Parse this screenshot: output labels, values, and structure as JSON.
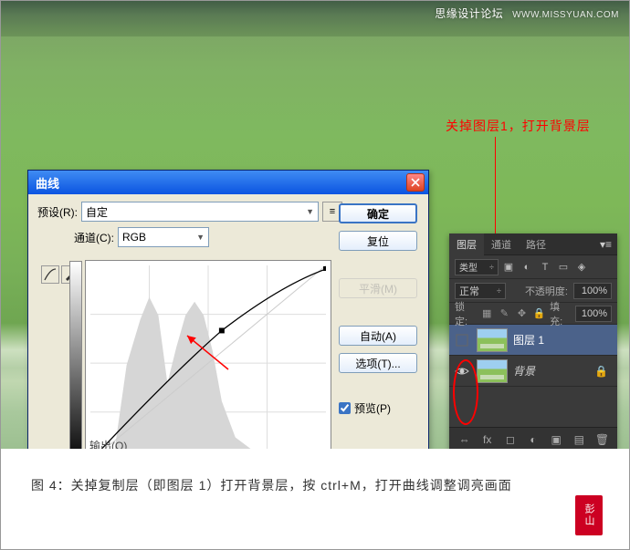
{
  "watermark": {
    "cn": "思缘设计论坛",
    "en": "WWW.MISSYUAN.COM"
  },
  "annotation": "关掉图层1，打开背景层",
  "curves": {
    "title": "曲线",
    "preset_label": "预设(R):",
    "preset_value": "自定",
    "channel_label": "通道(C):",
    "channel_value": "RGB",
    "output_label": "输出(O)",
    "buttons": {
      "ok": "确定",
      "cancel": "复位",
      "smooth": "平滑(M)",
      "auto": "自动(A)",
      "options": "选项(T)..."
    },
    "preview_label": "预览(P)"
  },
  "layers": {
    "tabs": {
      "layers": "图层",
      "channels": "通道",
      "paths": "路径"
    },
    "kind_label": "类型",
    "blend_mode": "正常",
    "opacity_label": "不透明度:",
    "opacity_value": "100%",
    "lock_label": "锁定:",
    "fill_label": "填充:",
    "fill_value": "100%",
    "items": [
      {
        "name": "图层 1",
        "visible": false,
        "locked": false
      },
      {
        "name": "背景",
        "visible": true,
        "locked": true
      }
    ]
  },
  "caption": "图 4：关掉复制层（即图层 1）打开背景层，按 ctrl+M，打开曲线调整调亮画面",
  "seal": "彭山"
}
